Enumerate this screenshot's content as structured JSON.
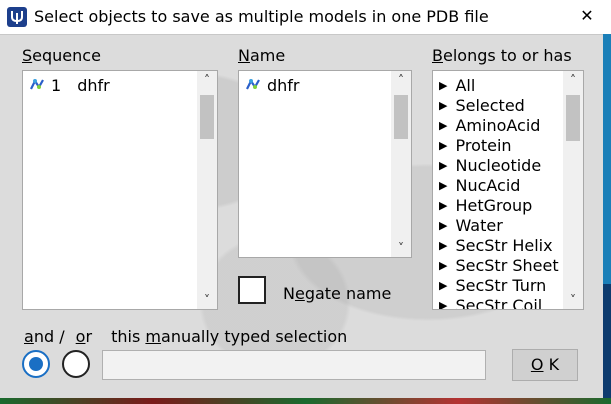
{
  "window": {
    "title": "Select objects to save as multiple models in one PDB file",
    "close_label": "✕"
  },
  "sequence": {
    "label_key": "S",
    "label_rest": "equence",
    "items": [
      {
        "index": "1",
        "name": "dhfr"
      }
    ]
  },
  "name": {
    "label_key": "N",
    "label_rest": "ame",
    "items": [
      {
        "name": "dhfr"
      }
    ]
  },
  "belongs": {
    "label_key": "B",
    "label_rest": "elongs to or has",
    "items": [
      "All",
      "Selected",
      "AminoAcid",
      "Protein",
      "Nucleotide",
      "NucAcid",
      "HetGroup",
      "Water",
      "SecStr Helix",
      "SecStr Sheet",
      "SecStr Turn",
      "SecStr Coil"
    ]
  },
  "negate": {
    "label_pre": "N",
    "label_key": "e",
    "label_rest": "gate name",
    "checked": false
  },
  "selection": {
    "and_key": "a",
    "and_rest": "nd",
    "slash": " / ",
    "or_key": "o",
    "or_rest": "r",
    "text_pre": "this ",
    "text_key": "m",
    "text_rest": "anually typed selection",
    "mode": "and",
    "value": ""
  },
  "ok": {
    "label_key": "O",
    "label_rest": "K"
  },
  "scroll_arrows": {
    "up": "˄",
    "down": "˅"
  }
}
